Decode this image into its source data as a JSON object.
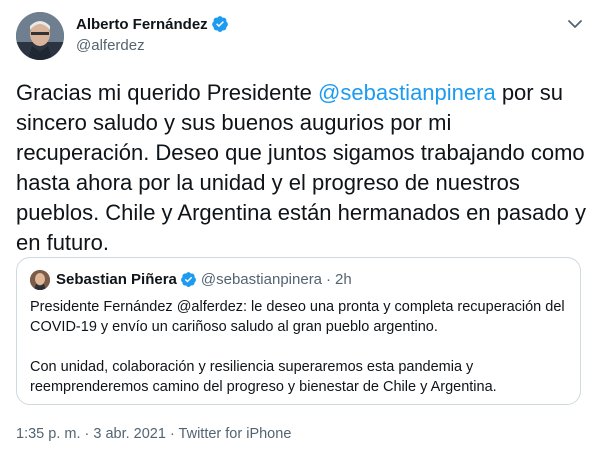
{
  "author": {
    "name": "Alberto Fernández",
    "handle": "@alferdez"
  },
  "tweet": {
    "text_before": "Gracias mi querido Presidente ",
    "mention": "@sebastianpinera",
    "text_after": " por su sincero saludo y sus buenos augurios por mi recuperación. Deseo que juntos sigamos trabajando como hasta ahora por la unidad y el progreso de nuestros pueblos. Chile y Argentina están hermanados en pasado y en futuro."
  },
  "quote": {
    "name": "Sebastian Piñera",
    "handle": "@sebastianpinera",
    "separator": "·",
    "time": "2h",
    "paragraphs": [
      "Presidente Fernández @alferdez: le deseo una pronta y completa recuperación del COVID-19 y envío un cariñoso saludo al gran pueblo argentino.",
      "Con unidad, colaboración y resiliencia superaremos esta pandemia y reemprenderemos camino del progreso y bienestar de Chile y Argentina."
    ]
  },
  "meta": {
    "text": "1:35 p. m. · 3 abr. 2021 · Twitter for iPhone"
  },
  "colors": {
    "accent": "#1d9bf0",
    "secondary_text": "#536471",
    "border": "#cfd9de"
  }
}
